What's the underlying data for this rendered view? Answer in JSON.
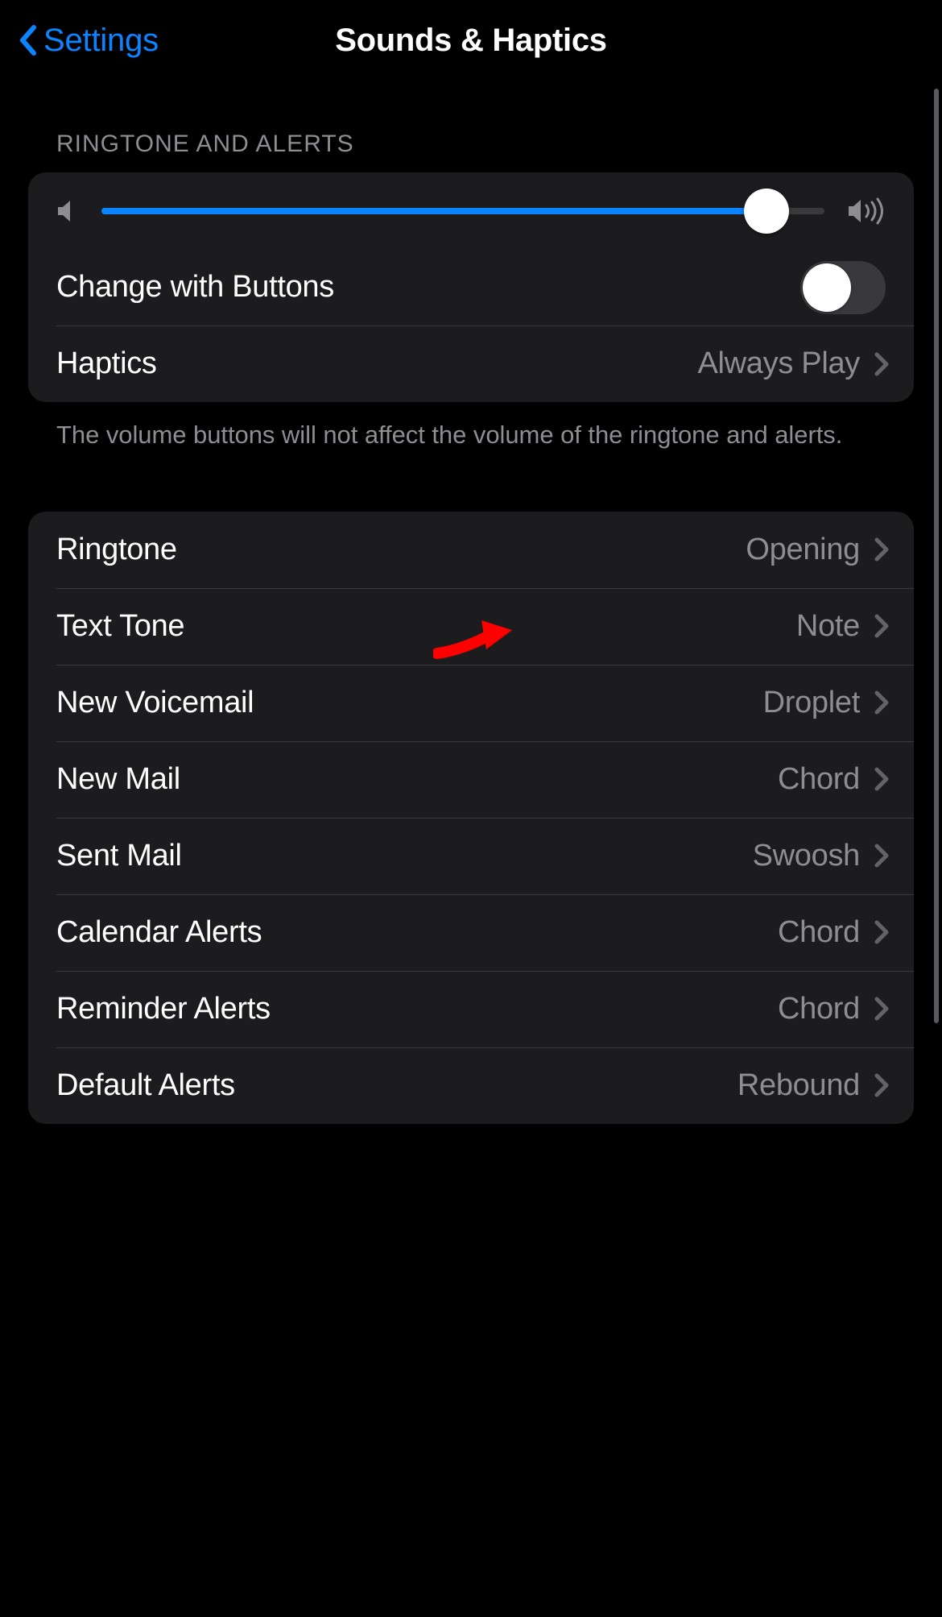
{
  "nav": {
    "back_label": "Settings",
    "title": "Sounds & Haptics"
  },
  "section1": {
    "header": "RINGTONE AND ALERTS",
    "slider_percent": 92,
    "change_with_buttons_label": "Change with Buttons",
    "change_with_buttons_on": false,
    "haptics_label": "Haptics",
    "haptics_value": "Always Play",
    "footer": "The volume buttons will not affect the volume of the ringtone and alerts."
  },
  "tones": [
    {
      "label": "Ringtone",
      "value": "Opening"
    },
    {
      "label": "Text Tone",
      "value": "Note"
    },
    {
      "label": "New Voicemail",
      "value": "Droplet"
    },
    {
      "label": "New Mail",
      "value": "Chord"
    },
    {
      "label": "Sent Mail",
      "value": "Swoosh"
    },
    {
      "label": "Calendar Alerts",
      "value": "Chord"
    },
    {
      "label": "Reminder Alerts",
      "value": "Chord"
    },
    {
      "label": "Default Alerts",
      "value": "Rebound"
    }
  ],
  "annotation": {
    "points_to_row_index": 1,
    "color": "#ff0000"
  }
}
